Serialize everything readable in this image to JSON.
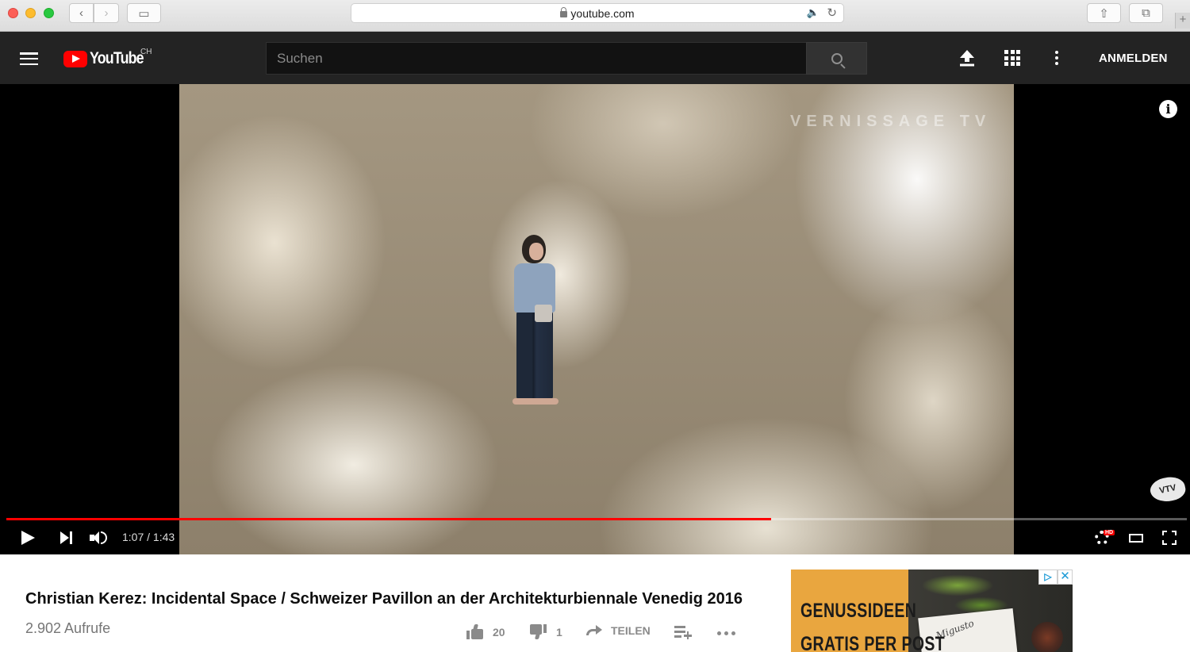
{
  "browser": {
    "url": "youtube.com"
  },
  "header": {
    "logo_text": "YouTube",
    "country_code": "CH",
    "search_placeholder": "Suchen",
    "signin_label": "ANMELDEN"
  },
  "player": {
    "watermark": "VERNISSAGE TV",
    "brand_mark": "VTV",
    "time_current": "1:07",
    "time_total": "1:43",
    "time_display": "1:07 / 1:43",
    "progress_fraction": 0.648,
    "hd_badge": "HD",
    "info_glyph": "i"
  },
  "video": {
    "title": "Christian Kerez: Incidental Space / Schweizer Pavillon an der Architekturbiennale Venedig 2016",
    "views": "2.902 Aufrufe",
    "likes": "20",
    "dislikes": "1",
    "share_label": "TEILEN"
  },
  "ad": {
    "headline": "GENUSSIDEEN",
    "subline": "GRATIS PER POST",
    "card_text": "Migusto",
    "adchoices_glyph": "▷",
    "close_glyph": "✕"
  },
  "colors": {
    "brand_red": "#ff0000",
    "header_bg": "#232323",
    "ad_bg": "#e9a63f"
  }
}
